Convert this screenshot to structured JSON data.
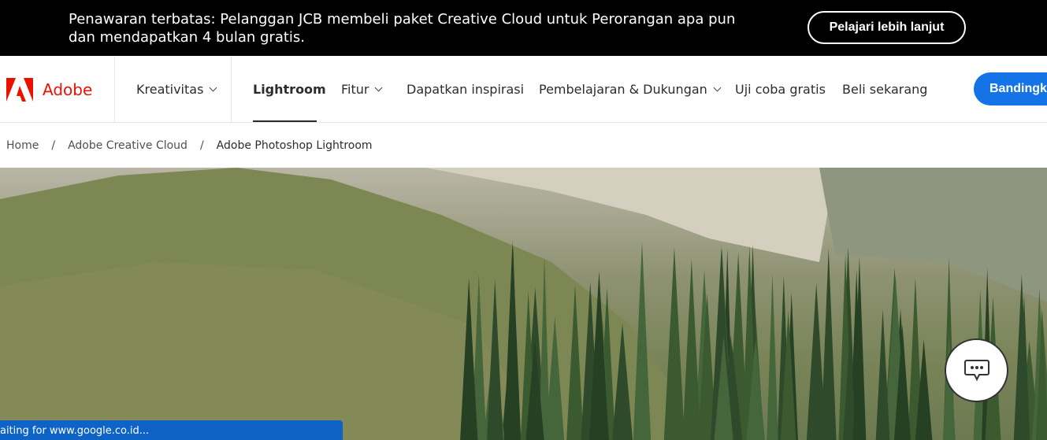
{
  "promo": {
    "text": "Penawaran terbatas: Pelanggan JCB membeli paket Creative Cloud untuk Perorangan apa pun dan mendapatkan 4 bulan gratis.",
    "button": "Pelajari lebih lanjut"
  },
  "nav": {
    "brand": "Adobe",
    "items": [
      "Kreativitas",
      "Lightroom",
      "Fitur",
      "Dapatkan inspirasi",
      "Pembelajaran & Dukungan",
      "Uji coba gratis",
      "Beli sekarang"
    ],
    "cta": "Bandingkan"
  },
  "breadcrumb": {
    "items": [
      "Home",
      "Adobe Creative Cloud",
      "Adobe Photoshop Lightroom"
    ],
    "separator": "/"
  },
  "status": {
    "text": "aiting for www.google.co.id..."
  },
  "colors": {
    "brand": "#eb1000",
    "cta": "#1473e6",
    "status": "#0d63c6"
  }
}
